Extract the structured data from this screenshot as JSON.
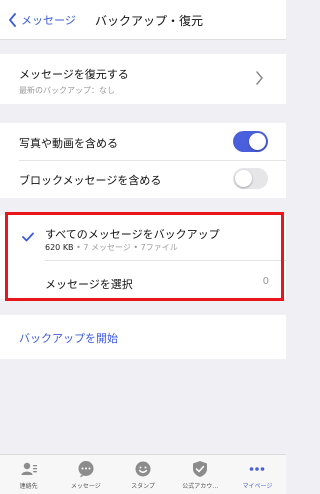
{
  "navbar": {
    "back_label": "メッセージ",
    "title": "バックアップ・復元"
  },
  "restore": {
    "title": "メッセージを復元する",
    "subtitle": "最新のバックアップ：なし"
  },
  "options": {
    "include_media_label": "写真や動画を含める",
    "include_media_on": true,
    "include_blocked_label": "ブロックメッセージを含める",
    "include_blocked_on": false
  },
  "backup": {
    "all_label": "すべてのメッセージをバックアップ",
    "size": "620 KB",
    "detail": " • 7 メッセージ • 7ファイル",
    "select_label": "メッセージを選択",
    "select_count": "0"
  },
  "start": {
    "label": "バックアップを開始"
  },
  "tabs": [
    {
      "label": "連絡先",
      "icon": "contacts-icon"
    },
    {
      "label": "メッセージ",
      "icon": "chat-icon"
    },
    {
      "label": "スタンプ",
      "icon": "sticker-icon"
    },
    {
      "label": "公式アカウ…",
      "icon": "shield-icon"
    },
    {
      "label": "マイページ",
      "icon": "more-icon"
    }
  ],
  "colors": {
    "accent": "#4a5fdb",
    "highlight": "#e8151a",
    "background": "#efeff4"
  }
}
